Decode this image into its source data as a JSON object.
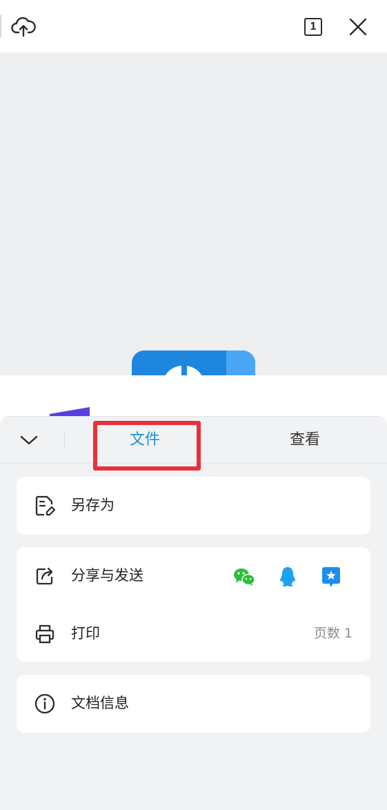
{
  "toolbar": {
    "cloud_icon": "cloud-upload-icon",
    "page_count": "1",
    "close_icon": "close-icon"
  },
  "tabs": [
    {
      "label": "文件",
      "active": true
    },
    {
      "label": "查看",
      "active": false
    }
  ],
  "menu": {
    "save_as": {
      "label": "另存为",
      "icon": "save-as-icon"
    },
    "share": {
      "label": "分享与发送",
      "icon": "share-icon",
      "targets": [
        "wechat-icon",
        "qq-icon",
        "tim-icon"
      ]
    },
    "print": {
      "label": "打印",
      "icon": "printer-icon",
      "value": "页数 1"
    },
    "doc_info": {
      "label": "文档信息",
      "icon": "info-icon"
    }
  },
  "colors": {
    "accent": "#1a8fd8",
    "highlight": "#e8303a",
    "wechat": "#2bbf3a",
    "qq": "#1aa3f0",
    "tim": "#1c8ef0"
  }
}
